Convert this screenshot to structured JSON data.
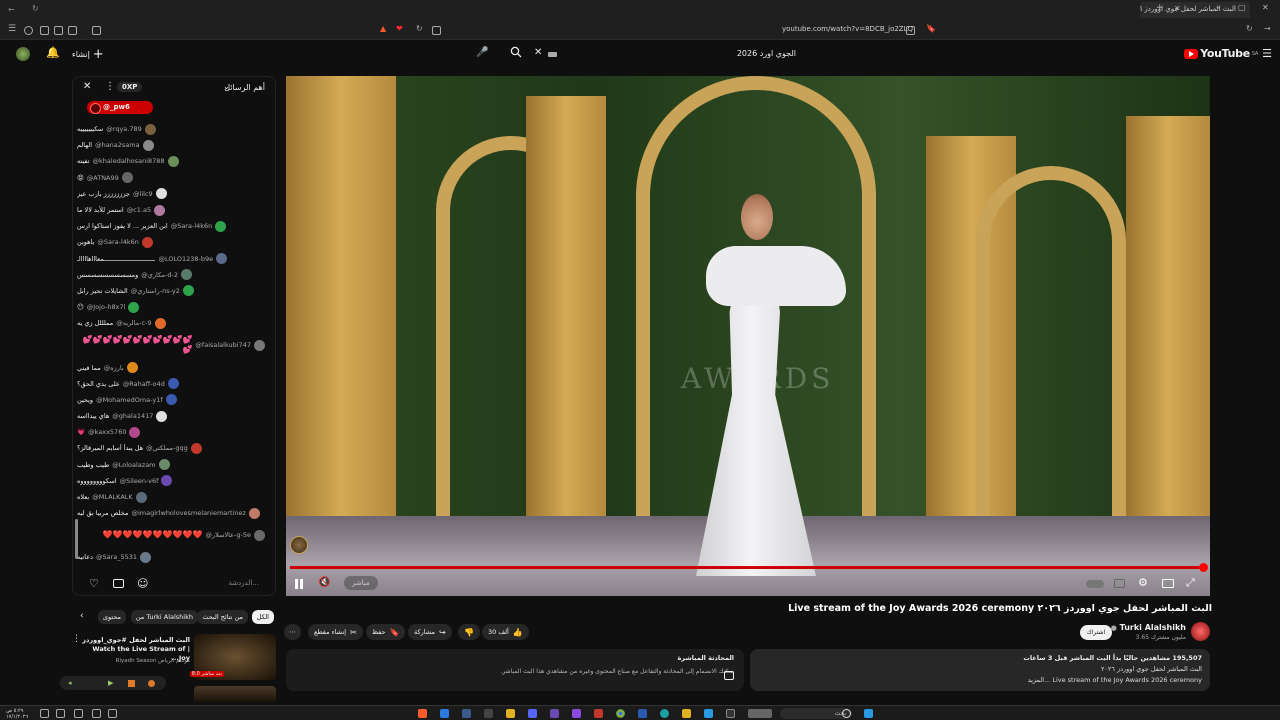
{
  "browser": {
    "tab_title": "البث المباشر لحفل جوي اووردز ٢٠٢٦",
    "url": "youtube.com/watch?v=8DCB_jo2ZLQ"
  },
  "header": {
    "search_query": "الجوي اورد 2026",
    "logo_text": "YouTube",
    "logo_region": "SA",
    "create_label": "إنشاء"
  },
  "chat": {
    "title": "أهم الرسائل",
    "xp_badge": "0XP",
    "user_chip": "@_pw6",
    "placeholder": "الدردشة...",
    "messages": [
      {
        "author": "@rqya.789",
        "text": "سكيييييييه",
        "color": "#7a6040"
      },
      {
        "author": "@hana2sama",
        "text": "الهالم",
        "color": "#8a8a8a"
      },
      {
        "author": "@khaledalhosani8788",
        "text": "تفيته",
        "color": "#6b8f5a"
      },
      {
        "author": "@ATNA99",
        "text": "😡",
        "color": "#666"
      },
      {
        "author": "@lilc9",
        "text": "جززززززز بارب عيز",
        "color": "#e0e0e0"
      },
      {
        "author": "@c1.a5",
        "text": "استمر للأبد لالا ما",
        "color": "#b07aa0"
      },
      {
        "author": "@Sara-l4k6n",
        "text": "ابن العزير ... لا يفوز استاكوا ارس",
        "color": "#2ea34a"
      },
      {
        "author": "@Sara-l4k6n",
        "text": "ياهوين",
        "color": "#c0392b"
      },
      {
        "author": "@LOLO1238-b9e",
        "text": "ـــــــــــــــــــــــــــمعاااهاااااـ",
        "color": "#5b6a8a"
      },
      {
        "author": "@مكاري-d-2",
        "text": "ومسسسسسسسسس",
        "color": "#5a7a6a"
      },
      {
        "author": "@راستاري-ns-y2",
        "text": "الشايلات تحيز رابل",
        "color": "#2ea34a"
      },
      {
        "author": "@Jojo-h8x7l",
        "text": "😶",
        "color": "#2ea34a"
      },
      {
        "author": "@مالريه-c-9",
        "text": "مملللل زي يه",
        "color": "#e06a2b"
      },
      {
        "author": "@faisalalkubi747",
        "text": "💕💕💕💕💕💕💕💕💕💕💕💕",
        "color": "#777",
        "hearts": true
      },
      {
        "author": "@بارزه",
        "text": "مما فيني",
        "color": "#e08a1a"
      },
      {
        "author": "@Rahaff-o4d",
        "text": "على يدي الحق؟",
        "color": "#3a5ab0"
      },
      {
        "author": "@MohamedOma-y1f",
        "text": "ويحين",
        "color": "#3a5ab0"
      },
      {
        "author": "@ghala1417",
        "text": "هاي ييدااسه",
        "color": "#e0e0e0"
      },
      {
        "author": "@kaxx5760",
        "text": "💗",
        "color": "#b04a8a"
      },
      {
        "author": "@مملكتي-gqg",
        "text": "هل يبدأ أسايم الميرقالز؟",
        "color": "#c0392b"
      },
      {
        "author": "@Loloalazam",
        "text": "طيب وطيب",
        "color": "#6a8a6a"
      },
      {
        "author": "@Sileen-v6f",
        "text": "اسكووووووووه",
        "color": "#6a4ab0"
      },
      {
        "author": "@MLALKALK",
        "text": "بعلاه",
        "color": "#5a6a7a"
      },
      {
        "author": "@imagirlwholovesmelaniemartinez",
        "text": "مخلص مربيا بق ليه",
        "color": "#c07a6a"
      },
      {
        "author": "@عالاسلار-g-5e",
        "text": "❤️❤️❤️❤️❤️❤️❤️❤️❤️❤️",
        "color": "#6a6a6a",
        "hearts": true
      },
      {
        "author": "@Sara_5531",
        "text": "دعاتيه",
        "color": "#6a7a8a"
      }
    ]
  },
  "player": {
    "live_label": "مباشر",
    "watermark": "AWARDS"
  },
  "video": {
    "title": "البث المباشر لحفل جوي اووردز ٢٠٢٦ Live stream of the Joy Awards 2026 ceremony",
    "channel": "Turki Alalshikh",
    "subscribers": "3.65 مليون مشترك",
    "subscribe_label": "اشتراك",
    "likes": "30 ألف",
    "share_label": "مشاركة",
    "save_label": "حفظ",
    "clip_label": "إنشاء مقطع"
  },
  "description": {
    "line1": "195,507 مشاهدين حاليًا  بدأ البث المباشر قبل 3 ساعات",
    "line2": "البث المباشر لحفل جوي اووردز ٢٠٢٦",
    "line3": "Live stream of the Joy Awards 2026 ceremony ...المزيد"
  },
  "chat_promo": {
    "title": "المحادثة المباشرة",
    "desc": "يمكنك الانضمام إلى المحادثة والتفاعل مع صناع المحتوى وغيره من مشاهدي هذا البث المباشر."
  },
  "recommendations": {
    "filters": [
      "الكل",
      "من نتائج البحث",
      "من Turki Alalshikh",
      "محتوى"
    ],
    "item": {
      "title": "البث المباشر لحفل #جوي_اووردز | Watch the Live Stream of Joy...",
      "channel": "موسم الرياض Riyadh Season",
      "badge": "8:0 بث مباشر"
    }
  },
  "taskbar": {
    "search_label": "بحث",
    "time": "٥:٢٩ ص",
    "date": "١٧/١/٢٠٢٦"
  }
}
